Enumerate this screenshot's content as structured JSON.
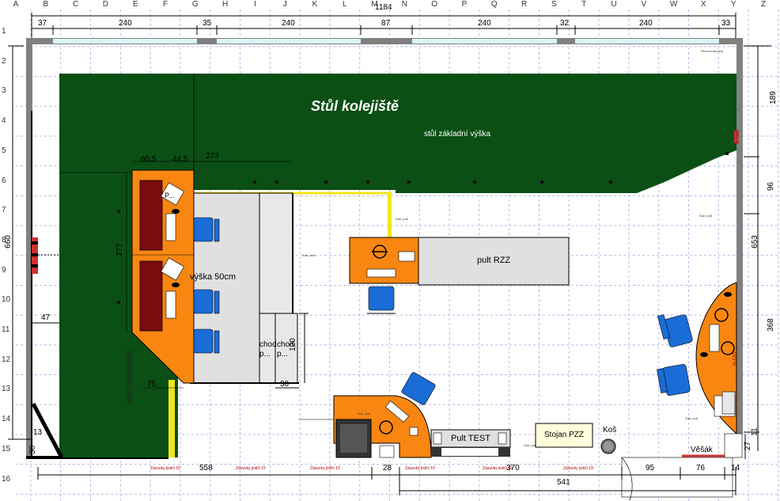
{
  "columns": [
    "A",
    "B",
    "C",
    "D",
    "E",
    "F",
    "G",
    "H",
    "I",
    "J",
    "K",
    "L",
    "M",
    "N",
    "O",
    "P",
    "Q",
    "R",
    "S",
    "T",
    "U",
    "V",
    "W",
    "X",
    "Y",
    "Z"
  ],
  "rows": [
    "1",
    "2",
    "3",
    "4",
    "5",
    "6",
    "7",
    "8",
    "9",
    "10",
    "11",
    "12",
    "13",
    "14",
    "15",
    "16"
  ],
  "top_dims": {
    "total": "1184",
    "segments": [
      "37",
      "240",
      "35",
      "240",
      "87",
      "240",
      "32",
      "240",
      "33"
    ]
  },
  "bottom_dims": {
    "a": "558",
    "b": "28",
    "c": "370",
    "d": "95",
    "e": "76",
    "f": "14",
    "g": "541"
  },
  "right_dims": {
    "total": "653",
    "a": "189",
    "b": "96",
    "c": "368",
    "d": "27",
    "e": "11"
  },
  "left_dims": {
    "total": "660",
    "a": "47",
    "b": "13",
    "c": "30"
  },
  "labels": {
    "table_title": "Stůl kolejiště",
    "table_sub": "stůl základní výška",
    "internet": "Přívod internetu",
    "inner_277": "277",
    "dim_60_5": "60,5",
    "dim_44_5": "44,5",
    "dim_273": "273",
    "dim_75": "75",
    "dim_30": "30",
    "dim_120": "120",
    "height50": "výška 50cm",
    "pult_rzz": "pult RZZ",
    "pult_test": "Pult TEST",
    "stojan": "Stojan PZZ",
    "kos": "Koš",
    "vesak": "Věšák",
    "chodba1": "chod p...",
    "chodba2": "chod p...",
    "p_label": "P...",
    "dir_label": "dle zákona(PB)",
    "sub_small": "Sub. pult",
    "zasuvky": "Zásuvky jističi 15",
    "zasuvky2": "Zásuvky jističi 19",
    "redlbl": "3x 230V"
  }
}
